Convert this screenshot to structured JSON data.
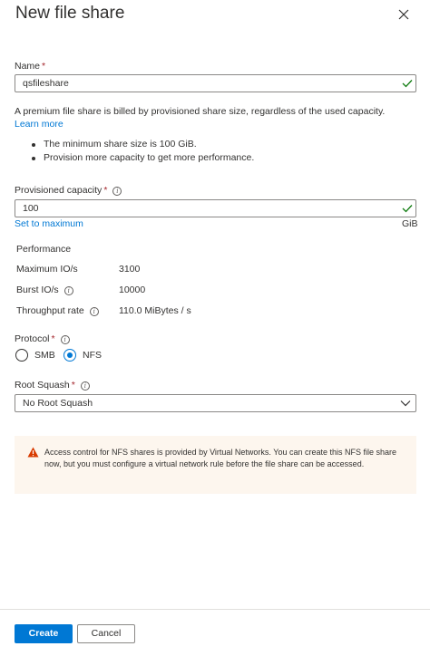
{
  "panel": {
    "title": "New file share"
  },
  "name_field": {
    "label": "Name",
    "required": "*",
    "value": "qsfileshare"
  },
  "info_text": {
    "description": "A premium file share is billed by provisioned share size, regardless of the used capacity.",
    "learn_more": "Learn more"
  },
  "bullets": [
    "The minimum share size is 100 GiB.",
    "Provision more capacity to get more performance."
  ],
  "capacity": {
    "label": "Provisioned capacity",
    "required": "*",
    "info": "i",
    "value": "100",
    "set_max": "Set to maximum",
    "unit": "GiB"
  },
  "performance": {
    "heading": "Performance",
    "rows": [
      {
        "label": "Maximum IO/s",
        "value": "3100"
      },
      {
        "label": "Burst IO/s",
        "value": "10000"
      },
      {
        "label": "Throughput rate",
        "value": "110.0 MiBytes / s"
      }
    ]
  },
  "protocol": {
    "label": "Protocol",
    "required": "*",
    "options": [
      "SMB",
      "NFS"
    ],
    "selected": "NFS"
  },
  "root_squash": {
    "label": "Root Squash",
    "required": "*",
    "value": "No Root Squash"
  },
  "warning": {
    "text": "Access control for NFS shares is provided by Virtual Networks. You can create this NFS file share now, but you must configure a virtual network rule before the file share can be accessed."
  },
  "footer": {
    "create": "Create",
    "cancel": "Cancel"
  },
  "colors": {
    "accent": "#0078d4",
    "success": "#107c10",
    "required": "#a4262c",
    "warning": "#d83b01"
  },
  "icons": {
    "close": "close-icon",
    "check": "checkmark-icon",
    "info": "info-icon",
    "chevron": "chevron-down-icon",
    "warning": "warning-icon"
  }
}
